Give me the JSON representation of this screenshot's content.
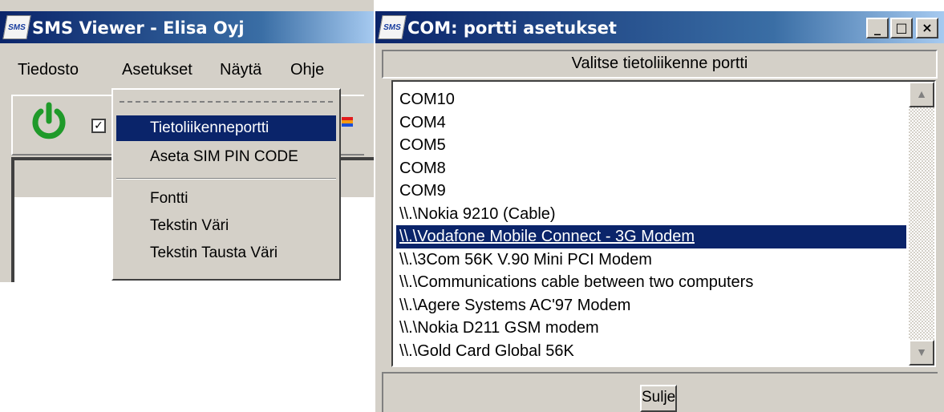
{
  "sms_window": {
    "icon_text": "SMS",
    "title": "SMS Viewer - Elisa Oyj",
    "menu": [
      "Tiedosto",
      "Asetukset",
      "Näytä",
      "Ohje"
    ],
    "checkbox_mark": "✓",
    "dropdown": {
      "items": [
        "Tietoliikenneportti",
        "Aseta SIM PIN CODE",
        "Fontti",
        "Tekstin Väri",
        "Tekstin Tausta Väri"
      ],
      "selected_index": 0
    }
  },
  "com_window": {
    "icon_text": "SMS",
    "title": "COM: portti asetukset",
    "buttons": {
      "minimize": "_",
      "maximize": "□",
      "close": "×"
    },
    "prompt": "Valitse tietoliikenne portti",
    "ports": [
      "COM10",
      "COM4",
      "COM5",
      "COM8",
      "COM9",
      "\\\\.\\Nokia 9210 (Cable)",
      "\\\\.\\Vodafone Mobile Connect - 3G Modem",
      "\\\\.\\3Com 56K V.90 Mini PCI Modem",
      "\\\\.\\Communications cable between two computers",
      "\\\\.\\Agere Systems AC'97 Modem",
      "\\\\.\\Nokia D211 GSM modem",
      "\\\\.\\Gold Card Global 56K"
    ],
    "selected_port_index": 6,
    "scroll_up": "▲",
    "scroll_down": "▼",
    "close_button": "Sulje"
  },
  "colors": {
    "face": "#d4d0c8",
    "title_start": "#0a246a",
    "title_end": "#a6caf0",
    "selection": "#0a246a",
    "power_green": "#1f9a2a"
  }
}
